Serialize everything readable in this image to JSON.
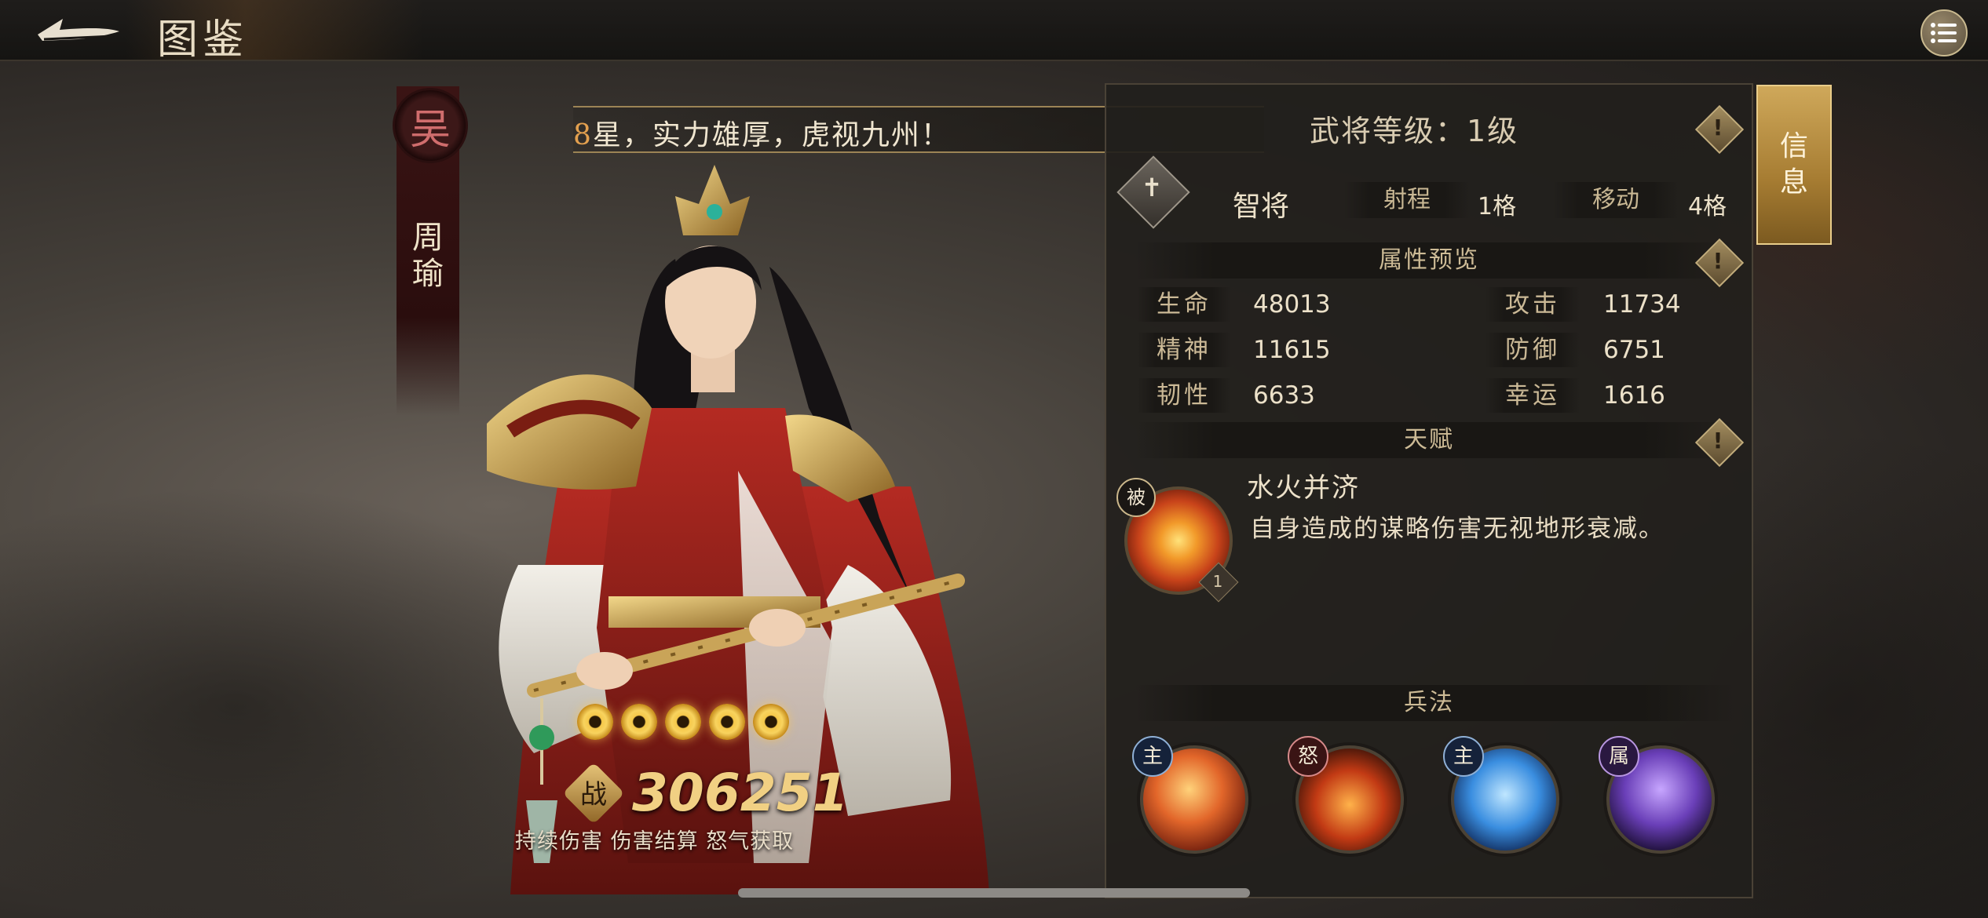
{
  "header": {
    "title": "图鉴",
    "back_icon": "back-arrow-icon",
    "menu_icon": "list-menu-icon"
  },
  "hero": {
    "faction": "吴",
    "name": "周瑜",
    "quote_highlight": "8",
    "quote_text": "星，实力雄厚，虎视九州！",
    "stars": 5,
    "power_glyph": "战",
    "power": "306251",
    "tags": "持续伤害 伤害结算 怒气获取"
  },
  "panel": {
    "level": "武将等级：1级",
    "class_name": "智将",
    "range_label": "射程",
    "range_value": "1格",
    "move_label": "移动",
    "move_value": "4格",
    "attributes_title": "属性预览",
    "stats": {
      "hp_label": "生命",
      "hp": "48013",
      "atk_label": "攻击",
      "atk": "11734",
      "spirit_label": "精神",
      "spirit": "11615",
      "def_label": "防御",
      "def": "6751",
      "tough_label": "韧性",
      "tough": "6633",
      "luck_label": "幸运",
      "luck": "1616"
    },
    "talent_title": "天赋",
    "talent": {
      "badge": "被",
      "level": "1",
      "name": "水火并济",
      "desc": "自身造成的谋略伤害无视地形衰减。"
    },
    "tactics_title": "兵法",
    "skills": [
      {
        "badge": "主"
      },
      {
        "badge": "怒"
      },
      {
        "badge": "主"
      },
      {
        "badge": "属"
      }
    ],
    "tip_glyph": "!"
  },
  "side_tab": {
    "label": "信息"
  },
  "colors": {
    "accent_gold": "#cfa85a",
    "power_gold": "#f1d083",
    "quote_highlight": "#e3a04f",
    "faction_red": "#d06d6d"
  }
}
